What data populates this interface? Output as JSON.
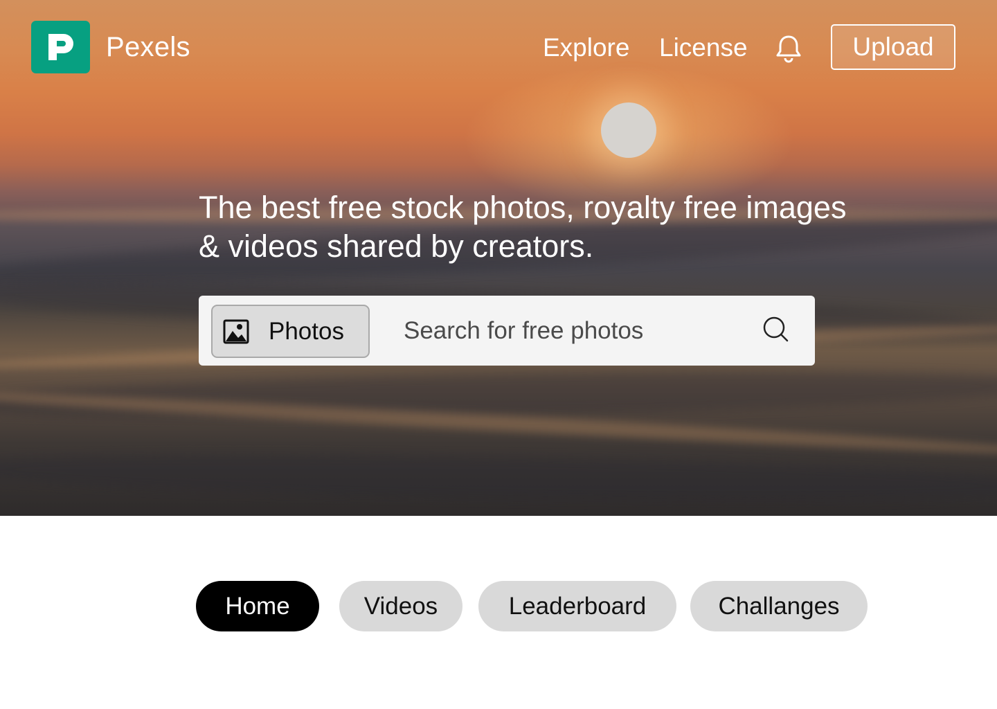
{
  "header": {
    "brand": "Pexels",
    "nav": [
      {
        "label": "Explore"
      },
      {
        "label": "License"
      }
    ],
    "notification_icon": "bell-icon",
    "upload_label": "Upload"
  },
  "hero": {
    "headline": "The best free stock photos, royalty free images & videos shared by creators."
  },
  "search": {
    "type_label": "Photos",
    "type_icon": "image-icon",
    "placeholder": "Search for free photos",
    "search_icon": "search-icon"
  },
  "tabs": [
    {
      "label": "Home",
      "active": true
    },
    {
      "label": "Videos",
      "active": false
    },
    {
      "label": "Leaderboard",
      "active": false
    },
    {
      "label": "Challanges",
      "active": false
    }
  ],
  "colors": {
    "brand": "#07a081",
    "active_tab": "#000000",
    "inactive_tab": "#d9d9d9"
  }
}
